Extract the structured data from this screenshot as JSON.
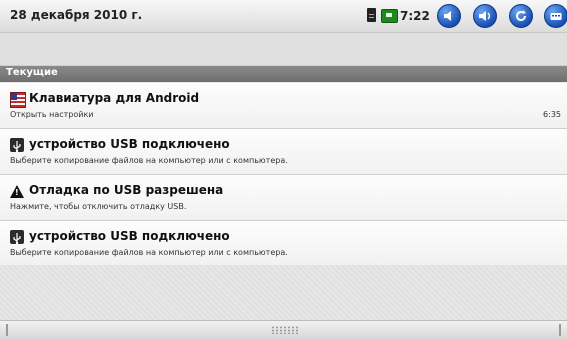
{
  "status_bar": {
    "date": "28 декабря 2010 г.",
    "time": "7:22",
    "icons": [
      "sim-card-icon",
      "battery-icon",
      "volume-down-icon",
      "volume-up-icon",
      "refresh-icon",
      "keyboard-icon"
    ]
  },
  "section_header": "Текущие",
  "notifications": [
    {
      "icon": "us-flag-icon",
      "title": "Клавиатура для Android",
      "subtitle": "Открыть настройки",
      "time": "6:35"
    },
    {
      "icon": "usb-icon",
      "title": "устройство USB подключено",
      "subtitle": "Выберите копирование файлов на компьютер или с компьютера."
    },
    {
      "icon": "warning-icon",
      "title": "Отладка по USB разрешена",
      "subtitle": "Нажмите, чтобы отключить отладку USB."
    },
    {
      "icon": "usb-icon",
      "title": "устройство USB подключено",
      "subtitle": "Выберите копирование файлов на компьютер или с компьютера."
    }
  ]
}
